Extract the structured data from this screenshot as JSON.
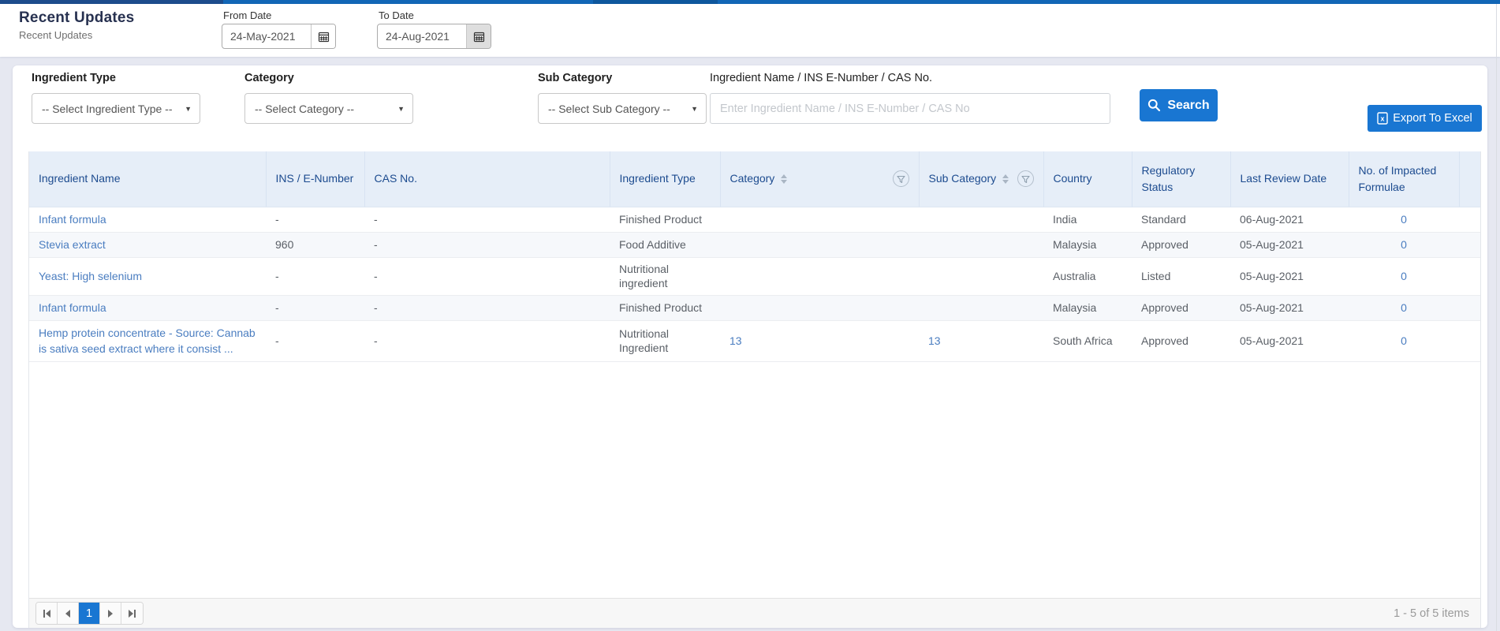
{
  "colors": {
    "topbar_blue": "#1266b6",
    "topbar_navy": "#1d4c8c",
    "accent_blue": "#1976d2",
    "link_blue": "#4a7dc0",
    "table_header_bg": "#e6eef8",
    "table_header_text": "#1c4b8f",
    "page_bg": "#e6e8f1"
  },
  "page_header": {
    "title": "Recent Updates",
    "subtitle": "Recent Updates",
    "from_date": {
      "label": "From Date",
      "value": "24-May-2021",
      "icon": "calendar-icon"
    },
    "to_date": {
      "label": "To Date",
      "value": "24-Aug-2021",
      "icon": "calendar-icon"
    }
  },
  "filters": {
    "ingredient_type": {
      "label": "Ingredient Type",
      "selected": "-- Select Ingredient Type --"
    },
    "category": {
      "label": "Category",
      "selected": "-- Select Category --"
    },
    "sub_category": {
      "label": "Sub Category",
      "selected": "-- Select Sub Category --"
    },
    "ingredient_search": {
      "label": "Ingredient Name / INS E-Number / CAS No.",
      "placeholder": "Enter Ingredient Name / INS E-Number / CAS No"
    },
    "search_button_label": "Search",
    "export_button_label": "Export To Excel"
  },
  "table": {
    "columns": [
      "Ingredient Name",
      "INS / E-Number",
      "CAS No.",
      "Ingredient Type",
      "Category",
      "Sub Category",
      "Country",
      "Regulatory Status",
      "Last Review Date",
      "No. of Impacted Formulae"
    ],
    "rows": [
      {
        "name": "Infant formula",
        "ins": "-",
        "cas": "-",
        "type": "Finished Product",
        "category": "",
        "sub_category": "",
        "country": "India",
        "status": "Standard",
        "last_review": "06-Aug-2021",
        "impacted": "0"
      },
      {
        "name": "Stevia extract",
        "ins": "960",
        "cas": "-",
        "type": "Food Additive",
        "category": "",
        "sub_category": "",
        "country": "Malaysia",
        "status": "Approved",
        "last_review": "05-Aug-2021",
        "impacted": "0"
      },
      {
        "name": "Yeast: High selenium",
        "ins": "-",
        "cas": "-",
        "type": "Nutritional ingredient",
        "category": "",
        "sub_category": "",
        "country": "Australia",
        "status": "Listed",
        "last_review": "05-Aug-2021",
        "impacted": "0"
      },
      {
        "name": "Infant formula",
        "ins": "-",
        "cas": "-",
        "type": "Finished Product",
        "category": "",
        "sub_category": "",
        "country": "Malaysia",
        "status": "Approved",
        "last_review": "05-Aug-2021",
        "impacted": "0"
      },
      {
        "name": "Hemp protein concentrate - Source: Cannabis sativa seed extract where it consist ...",
        "ins": "-",
        "cas": "-",
        "type": "Nutritional Ingredient",
        "category": "13",
        "sub_category": "13",
        "country": "South Africa",
        "status": "Approved",
        "last_review": "05-Aug-2021",
        "impacted": "0"
      }
    ]
  },
  "pagination": {
    "current_page": "1",
    "summary": "1 - 5 of 5 items",
    "icons": [
      "first-page-icon",
      "previous-page-icon",
      "next-page-icon",
      "last-page-icon"
    ]
  }
}
